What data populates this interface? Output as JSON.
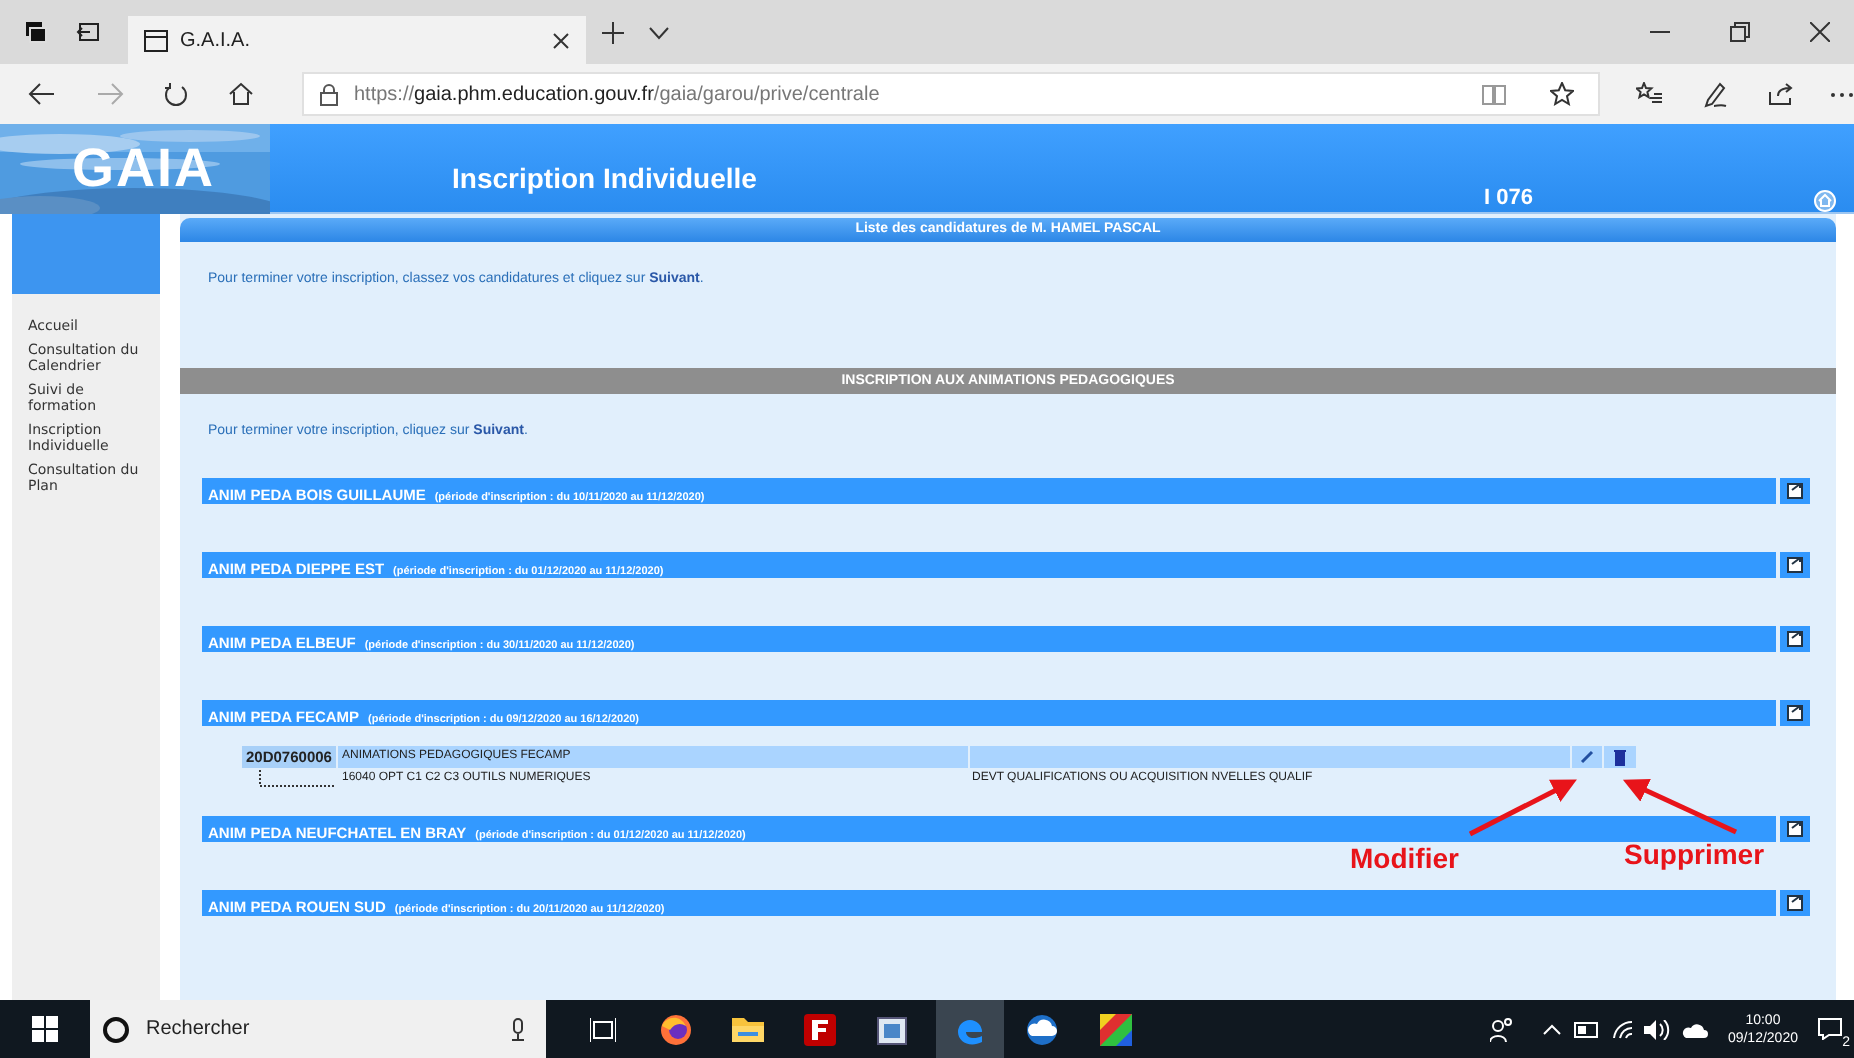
{
  "browser": {
    "tab_title": "G.A.I.A.",
    "url_scheme": "https://",
    "url_host": "gaia.phm.education.gouv.fr",
    "url_path": "/gaia/garou/prive/centrale"
  },
  "header": {
    "logo": "GAIA",
    "title": "Inscription Individuelle",
    "code": "I 076"
  },
  "sidebar": {
    "items": [
      "Accueil",
      "Consultation du Calendrier",
      "Suivi de formation",
      "Inscription Individuelle",
      "Consultation du Plan"
    ]
  },
  "candidatures": {
    "title": "Liste des candidatures de M. HAMEL PASCAL",
    "instruction": "Pour terminer votre inscription, classez vos candidatures et cliquez sur **Suivant**."
  },
  "inscription": {
    "title": "INSCRIPTION AUX ANIMATIONS PEDAGOGIQUES",
    "instruction": "Pour terminer votre inscription, cliquez sur **Suivant**.",
    "groups": [
      {
        "name": "ANIM PEDA BOIS GUILLAUME",
        "period": "(période d'inscription : du 10/11/2020 au 11/12/2020)"
      },
      {
        "name": "ANIM PEDA DIEPPE EST",
        "period": "(période d'inscription : du 01/12/2020 au 11/12/2020)"
      },
      {
        "name": "ANIM PEDA ELBEUF",
        "period": "(période d'inscription : du 30/11/2020 au 11/12/2020)"
      },
      {
        "name": "ANIM PEDA FECAMP",
        "period": "(période d'inscription : du 09/12/2020 au 16/12/2020)",
        "entries": [
          {
            "code": "20D0760006",
            "title": "ANIMATIONS PEDAGOGIQUES FECAMP",
            "module": "16040 OPT C1 C2 C3 OUTILS NUMERIQUES",
            "objective": "DEVT QUALIFICATIONS OU ACQUISITION NVELLES QUALIF"
          }
        ]
      },
      {
        "name": "ANIM PEDA NEUFCHATEL EN BRAY",
        "period": "(période d'inscription : du 01/12/2020 au 11/12/2020)"
      },
      {
        "name": "ANIM PEDA ROUEN SUD",
        "period": "(période d'inscription : du 20/11/2020 au 11/12/2020)"
      }
    ]
  },
  "annotations": [
    {
      "label": "Modifier",
      "kind": "edit"
    },
    {
      "label": "Supprimer",
      "kind": "delete"
    }
  ],
  "taskbar": {
    "search_placeholder": "Rechercher",
    "time": "10:00",
    "date": "09/12/2020",
    "notifications": "2"
  }
}
